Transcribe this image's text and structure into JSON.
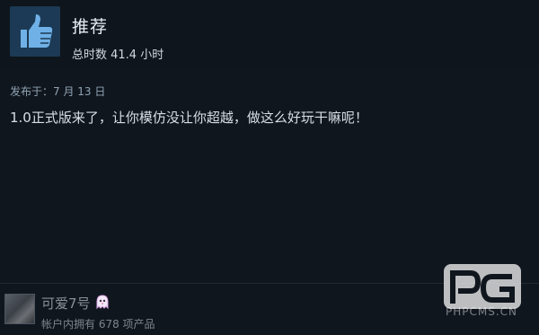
{
  "review": {
    "verdict": "推荐",
    "hours_text": "总时数 41.4 小时",
    "posted_text": "发布于：7 月 13 日",
    "body_text": "1.0正式版来了，让你模仿没让你超越，做这么好玩干嘛呢！"
  },
  "author": {
    "name": "可爱7号",
    "products_text": "帐户内拥有 678 项产品"
  },
  "watermark": {
    "text": "PHPCMS.CN"
  },
  "icons": {
    "thumb": "thumbs-up-icon",
    "badge": "ghost-icon"
  },
  "colors": {
    "background": "#10161e",
    "thumb_box": "#1c3a55",
    "thumb": "#6fb1e7"
  }
}
